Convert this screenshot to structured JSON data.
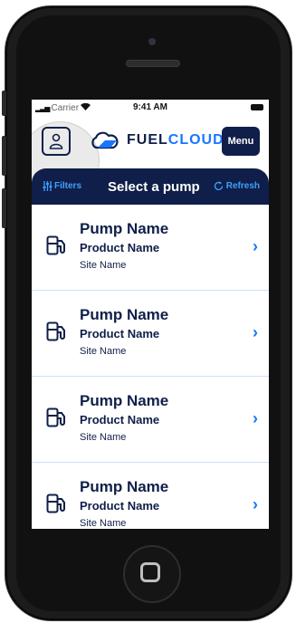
{
  "status_bar": {
    "carrier": "Carrier",
    "time": "9:41 AM"
  },
  "header": {
    "logo_text_dark": "FUEL",
    "logo_text_accent": "CLOUD",
    "menu_label": "Menu"
  },
  "toolbar": {
    "filters_label": "Filters",
    "title": "Select a pump",
    "refresh_label": "Refresh"
  },
  "pumps": [
    {
      "name": "Pump Name",
      "product": "Product Name",
      "site": "Site Name"
    },
    {
      "name": "Pump Name",
      "product": "Product Name",
      "site": "Site Name"
    },
    {
      "name": "Pump Name",
      "product": "Product Name",
      "site": "Site Name"
    },
    {
      "name": "Pump Name",
      "product": "Product Name",
      "site": "Site Name"
    }
  ],
  "colors": {
    "navy": "#0f1f49",
    "accent": "#1976ff"
  },
  "icons": [
    "user-icon",
    "cloud-logo-icon",
    "filter-icon",
    "refresh-icon",
    "fuel-pump-icon",
    "chevron-right-icon"
  ]
}
